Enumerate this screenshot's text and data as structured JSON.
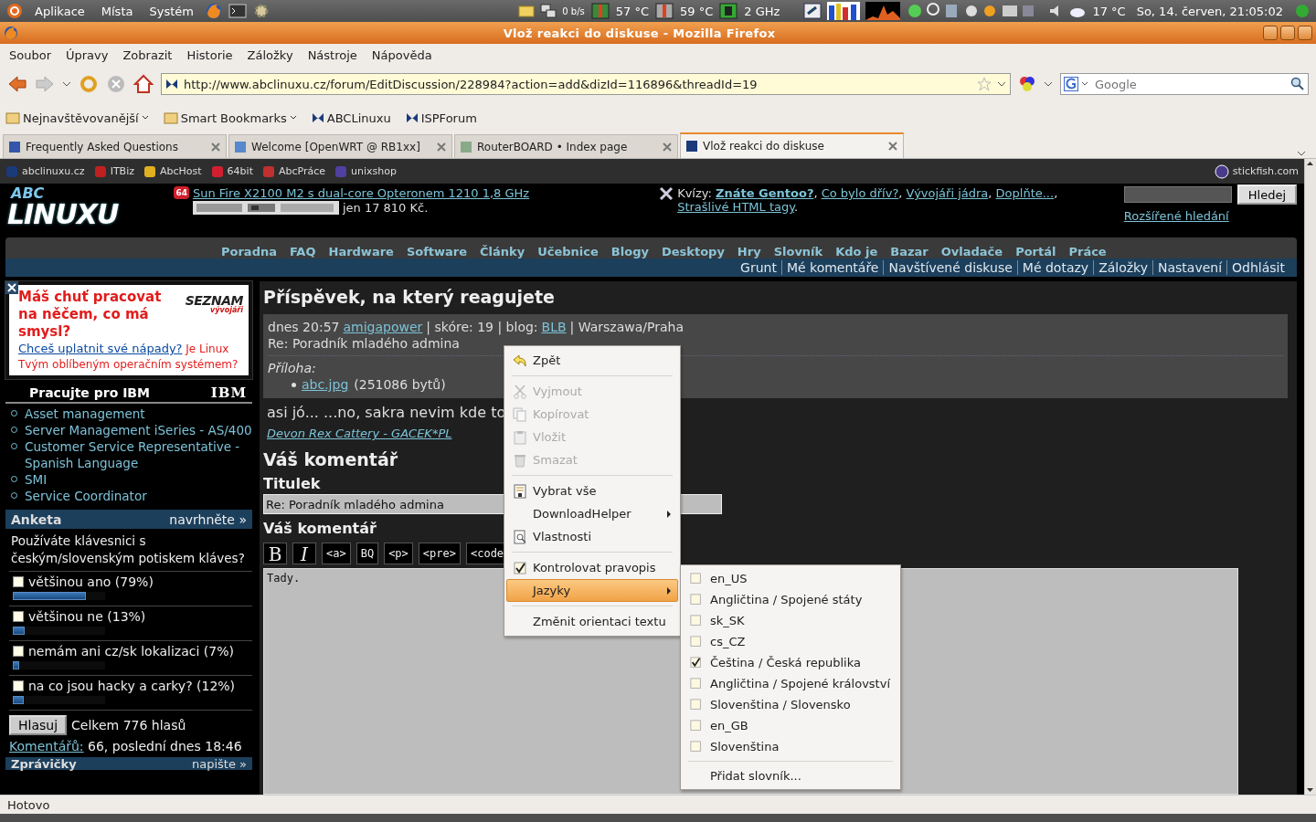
{
  "panel": {
    "menus": [
      "Aplikace",
      "Místa",
      "Systém"
    ],
    "net": "0 b/s",
    "temp1": "57 °C",
    "temp2": "59 °C",
    "cpu": "2 GHz",
    "weather": "17 °C",
    "clock": "So, 14. červen, 21:05:02"
  },
  "window": {
    "title": "Vlož reakci do diskuse - Mozilla Firefox"
  },
  "menu_bar": [
    "Soubor",
    "Úpravy",
    "Zobrazit",
    "Historie",
    "Záložky",
    "Nástroje",
    "Nápověda"
  ],
  "toolbar": {
    "url": "http://www.abclinuxu.cz/forum/EditDiscussion/228984?action=add&dizId=116896&threadId=19",
    "search_placeholder": "Google"
  },
  "bookmarks": [
    {
      "label": "Nejnavštěvovanější",
      "kind": "folder"
    },
    {
      "label": "Smart Bookmarks",
      "kind": "folder"
    },
    {
      "label": "ABCLinuxu",
      "kind": "site"
    },
    {
      "label": "ISPForum",
      "kind": "site"
    }
  ],
  "tabs": [
    {
      "label": "Frequently Asked Questions",
      "selected": false
    },
    {
      "label": "Welcome [OpenWRT @ RB1xx]",
      "selected": false
    },
    {
      "label": "RouterBOARD • Index page",
      "selected": false
    },
    {
      "label": "Vlož reakci do diskuse",
      "selected": true
    }
  ],
  "site_links": [
    "abclinuxu.cz",
    "ITBiz",
    "AbcHost",
    "64bit",
    "AbcPráce",
    "unixshop"
  ],
  "site_link_right": "stickfish.com",
  "header": {
    "logo_top": "ABC",
    "logo_bottom": "LINUXU",
    "ad_badge": "64",
    "ad_title": "Sun Fire X2100 M2 s dual-core Opteronem 1210 1,8 GHz",
    "ad_price": "jen 17 810 Kč.",
    "quiz_label": "Kvízy:",
    "quizzes": [
      {
        "text": "Znáte Gentoo?",
        "highlighted": true,
        "after": ","
      },
      {
        "text": "Co bylo dřív?",
        "highlighted": false,
        "after": ","
      },
      {
        "text": "Vývojáři jádra",
        "highlighted": false,
        "after": ","
      },
      {
        "text": "Doplňte...",
        "highlighted": false,
        "after": ","
      },
      {
        "text": "Strašlivé HTML tagy",
        "highlighted": false,
        "after": "."
      }
    ],
    "search_button": "Hledej",
    "advanced_search": "Rozšířené hledání"
  },
  "main_nav": [
    "Poradna",
    "FAQ",
    "Hardware",
    "Software",
    "Články",
    "Učebnice",
    "Blogy",
    "Desktopy",
    "Hry",
    "Slovník",
    "Kdo je",
    "Bazar",
    "Ovladače",
    "Portál",
    "Práce"
  ],
  "user_nav": [
    "Grunt",
    "Mé komentáře",
    "Navštívené diskuse",
    "Mé dotazy",
    "Záložky",
    "Nastavení",
    "Odhlásit"
  ],
  "promo": {
    "headline": "Máš chuť pracovat na něčem, co má smysl?",
    "link": "Chceš uplatnit své nápady?",
    "text": "Je Linux Tvým oblíbeným operačním systémem?",
    "logo": "SEZNAM",
    "logo_sub": "vývojáři"
  },
  "jobs": {
    "title": "Pracujte pro IBM",
    "logo": "IBM",
    "items": [
      "Asset management",
      "Server Management iSeries - AS/400",
      "Customer Service Representative - Spanish Language",
      "SMI",
      "Service Coordinator"
    ]
  },
  "poll": {
    "title": "Anketa",
    "suggest": "navrhněte »",
    "question": "Používáte klávesnici s českým/slovenským potiskem kláves?",
    "options": [
      {
        "label": "většinou ano (79%)",
        "checked": false,
        "level": 0.79
      },
      {
        "label": "většinou ne (13%)",
        "checked": false,
        "level": 0.13
      },
      {
        "label": "nemám ani cz/sk lokalizaci (7%)",
        "checked": false,
        "level": 0.07
      },
      {
        "label": "na co jsou hacky a carky? (12%)",
        "checked": false,
        "level": 0.12
      }
    ],
    "vote_button": "Hlasuj",
    "total": "Celkem 776 hlasů",
    "comments_link": "Komentářů:",
    "comments_text": "66, poslední dnes 18:46"
  },
  "news": {
    "title": "Zprávičky",
    "suggest": "napište »"
  },
  "post": {
    "heading": "Příspěvek, na který reagujete",
    "time": "dnes 20:57",
    "author": "amigapower",
    "score_blog": "| skóre: 19 | blog:",
    "blog": "BLB",
    "location": "| Warszawa/Praha",
    "subject": "Re: Poradník mladého admina",
    "attachment_label": "Příloha:",
    "attachment": "abc.jpg",
    "attachment_size": "(251086 bytů)",
    "text": "asi jó... ...no, sakra nevim kde to",
    "signature": "Devon Rex Cattery - GACEK*PL"
  },
  "form": {
    "heading": "Váš komentář",
    "title_label": "Titulek",
    "title_value": "Re: Poradník mladého admina",
    "comment_label": "Váš komentář",
    "buttons": [
      "B",
      "I",
      "<a>",
      "BQ",
      "<p>",
      "<pre>",
      "<code"
    ],
    "comment_value": "Tady."
  },
  "context_menu": [
    {
      "kind": "undo",
      "label": "Zpět",
      "disabled": false
    },
    {
      "kind": "separator"
    },
    {
      "kind": "cut",
      "label": "Vyjmout",
      "disabled": true
    },
    {
      "kind": "copy",
      "label": "Kopírovat",
      "disabled": true
    },
    {
      "kind": "paste",
      "label": "Vložit",
      "disabled": true
    },
    {
      "kind": "delete",
      "label": "Smazat",
      "disabled": true
    },
    {
      "kind": "separator"
    },
    {
      "kind": "select_all",
      "label": "Vybrat vše",
      "disabled": false
    },
    {
      "kind": "submenu",
      "label": "DownloadHelper",
      "selected": false
    },
    {
      "kind": "properties",
      "label": "Vlastnosti",
      "disabled": false
    },
    {
      "kind": "separator"
    },
    {
      "kind": "check",
      "label": "Kontrolovat pravopis",
      "checked": true
    },
    {
      "kind": "submenu",
      "label": "Jazyky",
      "selected": true
    },
    {
      "kind": "separator"
    },
    {
      "kind": "plain",
      "label": "Změnit orientaci textu",
      "disabled": false
    }
  ],
  "language_menu": {
    "languages": [
      {
        "label": "en_US",
        "checked": false
      },
      {
        "label": "Angličtina / Spojené státy",
        "checked": false
      },
      {
        "label": "sk_SK",
        "checked": false
      },
      {
        "label": "cs_CZ",
        "checked": false
      },
      {
        "label": "Čeština / Česká republika",
        "checked": true
      },
      {
        "label": "Angličtina / Spojené království",
        "checked": false
      },
      {
        "label": "Slovenština / Slovensko",
        "checked": false
      },
      {
        "label": "en_GB",
        "checked": false
      },
      {
        "label": "Slovenština",
        "checked": false
      }
    ],
    "add": "Přidat slovník..."
  },
  "status_bar": "Hotovo"
}
